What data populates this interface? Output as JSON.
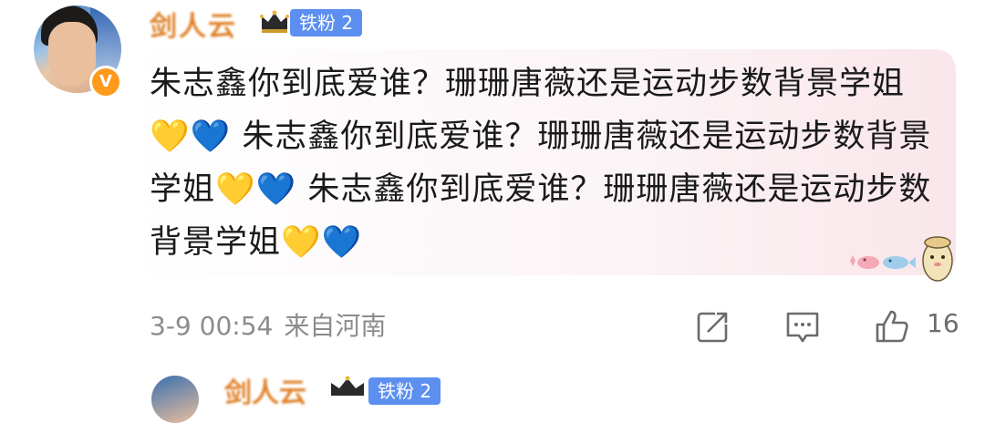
{
  "comment": {
    "username": "剑人云",
    "fan_badge": "铁粉 2",
    "verified_badge": "V",
    "text_segments": [
      "朱志鑫你到底爱谁？珊珊唐薇还是运动步数背景学姐",
      "💛",
      "💙",
      " 朱志鑫你到底爱谁？珊珊唐薇还是运动步数背景学姐",
      "💛",
      "💙",
      " 朱志鑫你到底爱谁？珊珊唐薇还是运动步数背景学姐",
      "💛",
      "💙"
    ],
    "timestamp": "3-9 00:54",
    "location": "来自河南",
    "like_count": "16"
  },
  "next_comment": {
    "username": "剑人云",
    "fan_badge": "铁粉 2"
  },
  "colors": {
    "username": "#e0822a",
    "fan_badge_bg": "#5c8ff0",
    "verified_bg": "#ff9a1c",
    "meta_text": "#8c8c8c",
    "bubble_tint": "#f9e6ea"
  },
  "icons": {
    "share": "share-icon",
    "comment": "comment-icon",
    "like": "thumbs-up-icon",
    "crown": "crown-icon",
    "sticker": "cartoon-sticker-icon"
  }
}
